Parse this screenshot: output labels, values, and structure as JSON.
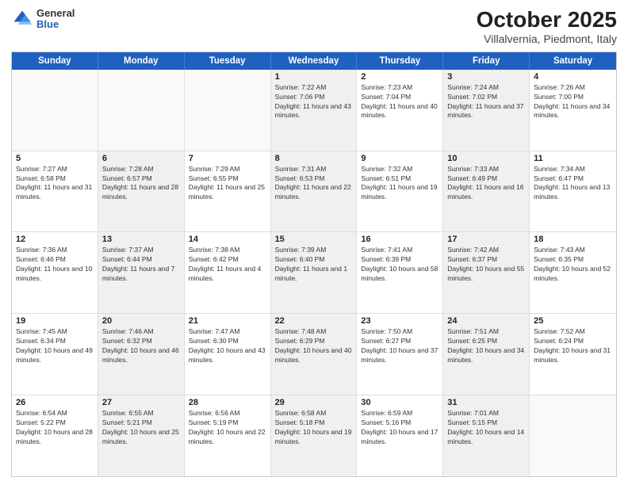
{
  "header": {
    "logo": {
      "general": "General",
      "blue": "Blue"
    },
    "title": "October 2025",
    "subtitle": "Villalvernia, Piedmont, Italy"
  },
  "weekdays": [
    "Sunday",
    "Monday",
    "Tuesday",
    "Wednesday",
    "Thursday",
    "Friday",
    "Saturday"
  ],
  "weeks": [
    [
      {
        "day": "",
        "sunrise": "",
        "sunset": "",
        "daylight": "",
        "shaded": false,
        "empty": true
      },
      {
        "day": "",
        "sunrise": "",
        "sunset": "",
        "daylight": "",
        "shaded": false,
        "empty": true
      },
      {
        "day": "",
        "sunrise": "",
        "sunset": "",
        "daylight": "",
        "shaded": false,
        "empty": true
      },
      {
        "day": "1",
        "sunrise": "Sunrise: 7:22 AM",
        "sunset": "Sunset: 7:06 PM",
        "daylight": "Daylight: 11 hours and 43 minutes.",
        "shaded": true,
        "empty": false
      },
      {
        "day": "2",
        "sunrise": "Sunrise: 7:23 AM",
        "sunset": "Sunset: 7:04 PM",
        "daylight": "Daylight: 11 hours and 40 minutes.",
        "shaded": false,
        "empty": false
      },
      {
        "day": "3",
        "sunrise": "Sunrise: 7:24 AM",
        "sunset": "Sunset: 7:02 PM",
        "daylight": "Daylight: 11 hours and 37 minutes.",
        "shaded": true,
        "empty": false
      },
      {
        "day": "4",
        "sunrise": "Sunrise: 7:26 AM",
        "sunset": "Sunset: 7:00 PM",
        "daylight": "Daylight: 11 hours and 34 minutes.",
        "shaded": false,
        "empty": false
      }
    ],
    [
      {
        "day": "5",
        "sunrise": "Sunrise: 7:27 AM",
        "sunset": "Sunset: 6:58 PM",
        "daylight": "Daylight: 11 hours and 31 minutes.",
        "shaded": false,
        "empty": false
      },
      {
        "day": "6",
        "sunrise": "Sunrise: 7:28 AM",
        "sunset": "Sunset: 6:57 PM",
        "daylight": "Daylight: 11 hours and 28 minutes.",
        "shaded": true,
        "empty": false
      },
      {
        "day": "7",
        "sunrise": "Sunrise: 7:29 AM",
        "sunset": "Sunset: 6:55 PM",
        "daylight": "Daylight: 11 hours and 25 minutes.",
        "shaded": false,
        "empty": false
      },
      {
        "day": "8",
        "sunrise": "Sunrise: 7:31 AM",
        "sunset": "Sunset: 6:53 PM",
        "daylight": "Daylight: 11 hours and 22 minutes.",
        "shaded": true,
        "empty": false
      },
      {
        "day": "9",
        "sunrise": "Sunrise: 7:32 AM",
        "sunset": "Sunset: 6:51 PM",
        "daylight": "Daylight: 11 hours and 19 minutes.",
        "shaded": false,
        "empty": false
      },
      {
        "day": "10",
        "sunrise": "Sunrise: 7:33 AM",
        "sunset": "Sunset: 6:49 PM",
        "daylight": "Daylight: 11 hours and 16 minutes.",
        "shaded": true,
        "empty": false
      },
      {
        "day": "11",
        "sunrise": "Sunrise: 7:34 AM",
        "sunset": "Sunset: 6:47 PM",
        "daylight": "Daylight: 11 hours and 13 minutes.",
        "shaded": false,
        "empty": false
      }
    ],
    [
      {
        "day": "12",
        "sunrise": "Sunrise: 7:36 AM",
        "sunset": "Sunset: 6:46 PM",
        "daylight": "Daylight: 11 hours and 10 minutes.",
        "shaded": false,
        "empty": false
      },
      {
        "day": "13",
        "sunrise": "Sunrise: 7:37 AM",
        "sunset": "Sunset: 6:44 PM",
        "daylight": "Daylight: 11 hours and 7 minutes.",
        "shaded": true,
        "empty": false
      },
      {
        "day": "14",
        "sunrise": "Sunrise: 7:38 AM",
        "sunset": "Sunset: 6:42 PM",
        "daylight": "Daylight: 11 hours and 4 minutes.",
        "shaded": false,
        "empty": false
      },
      {
        "day": "15",
        "sunrise": "Sunrise: 7:39 AM",
        "sunset": "Sunset: 6:40 PM",
        "daylight": "Daylight: 11 hours and 1 minute.",
        "shaded": true,
        "empty": false
      },
      {
        "day": "16",
        "sunrise": "Sunrise: 7:41 AM",
        "sunset": "Sunset: 6:39 PM",
        "daylight": "Daylight: 10 hours and 58 minutes.",
        "shaded": false,
        "empty": false
      },
      {
        "day": "17",
        "sunrise": "Sunrise: 7:42 AM",
        "sunset": "Sunset: 6:37 PM",
        "daylight": "Daylight: 10 hours and 55 minutes.",
        "shaded": true,
        "empty": false
      },
      {
        "day": "18",
        "sunrise": "Sunrise: 7:43 AM",
        "sunset": "Sunset: 6:35 PM",
        "daylight": "Daylight: 10 hours and 52 minutes.",
        "shaded": false,
        "empty": false
      }
    ],
    [
      {
        "day": "19",
        "sunrise": "Sunrise: 7:45 AM",
        "sunset": "Sunset: 6:34 PM",
        "daylight": "Daylight: 10 hours and 49 minutes.",
        "shaded": false,
        "empty": false
      },
      {
        "day": "20",
        "sunrise": "Sunrise: 7:46 AM",
        "sunset": "Sunset: 6:32 PM",
        "daylight": "Daylight: 10 hours and 46 minutes.",
        "shaded": true,
        "empty": false
      },
      {
        "day": "21",
        "sunrise": "Sunrise: 7:47 AM",
        "sunset": "Sunset: 6:30 PM",
        "daylight": "Daylight: 10 hours and 43 minutes.",
        "shaded": false,
        "empty": false
      },
      {
        "day": "22",
        "sunrise": "Sunrise: 7:48 AM",
        "sunset": "Sunset: 6:29 PM",
        "daylight": "Daylight: 10 hours and 40 minutes.",
        "shaded": true,
        "empty": false
      },
      {
        "day": "23",
        "sunrise": "Sunrise: 7:50 AM",
        "sunset": "Sunset: 6:27 PM",
        "daylight": "Daylight: 10 hours and 37 minutes.",
        "shaded": false,
        "empty": false
      },
      {
        "day": "24",
        "sunrise": "Sunrise: 7:51 AM",
        "sunset": "Sunset: 6:25 PM",
        "daylight": "Daylight: 10 hours and 34 minutes.",
        "shaded": true,
        "empty": false
      },
      {
        "day": "25",
        "sunrise": "Sunrise: 7:52 AM",
        "sunset": "Sunset: 6:24 PM",
        "daylight": "Daylight: 10 hours and 31 minutes.",
        "shaded": false,
        "empty": false
      }
    ],
    [
      {
        "day": "26",
        "sunrise": "Sunrise: 6:54 AM",
        "sunset": "Sunset: 5:22 PM",
        "daylight": "Daylight: 10 hours and 28 minutes.",
        "shaded": false,
        "empty": false
      },
      {
        "day": "27",
        "sunrise": "Sunrise: 6:55 AM",
        "sunset": "Sunset: 5:21 PM",
        "daylight": "Daylight: 10 hours and 25 minutes.",
        "shaded": true,
        "empty": false
      },
      {
        "day": "28",
        "sunrise": "Sunrise: 6:56 AM",
        "sunset": "Sunset: 5:19 PM",
        "daylight": "Daylight: 10 hours and 22 minutes.",
        "shaded": false,
        "empty": false
      },
      {
        "day": "29",
        "sunrise": "Sunrise: 6:58 AM",
        "sunset": "Sunset: 5:18 PM",
        "daylight": "Daylight: 10 hours and 19 minutes.",
        "shaded": true,
        "empty": false
      },
      {
        "day": "30",
        "sunrise": "Sunrise: 6:59 AM",
        "sunset": "Sunset: 5:16 PM",
        "daylight": "Daylight: 10 hours and 17 minutes.",
        "shaded": false,
        "empty": false
      },
      {
        "day": "31",
        "sunrise": "Sunrise: 7:01 AM",
        "sunset": "Sunset: 5:15 PM",
        "daylight": "Daylight: 10 hours and 14 minutes.",
        "shaded": true,
        "empty": false
      },
      {
        "day": "",
        "sunrise": "",
        "sunset": "",
        "daylight": "",
        "shaded": false,
        "empty": true
      }
    ]
  ]
}
